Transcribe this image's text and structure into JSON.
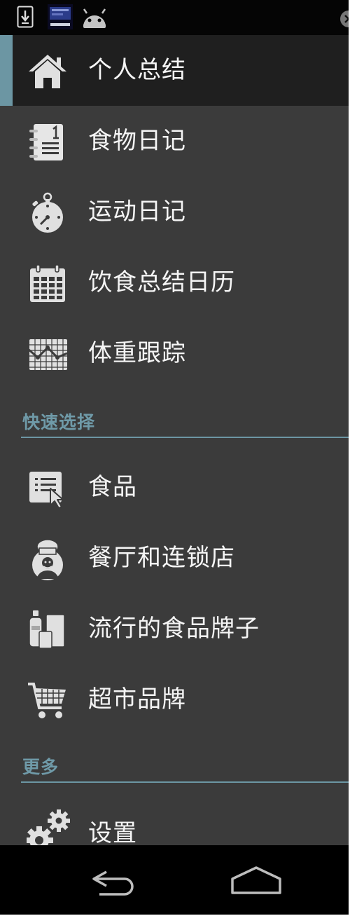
{
  "drawer": {
    "main_items": [
      {
        "label": "个人总结",
        "icon": "home-icon",
        "active": true
      },
      {
        "label": "食物日记",
        "icon": "notebook-icon"
      },
      {
        "label": "运动日记",
        "icon": "stopwatch-icon"
      },
      {
        "label": "饮食总结日历",
        "icon": "calendar-icon"
      },
      {
        "label": "体重跟踪",
        "icon": "weight-chart-icon"
      }
    ],
    "quick_select": {
      "title": "快速选择",
      "items": [
        {
          "label": "食品",
          "icon": "food-list-icon"
        },
        {
          "label": "餐厅和连锁店",
          "icon": "chef-icon"
        },
        {
          "label": "流行的食品牌子",
          "icon": "grocery-icon"
        },
        {
          "label": "超市品牌",
          "icon": "shopping-cart-icon"
        }
      ]
    },
    "more": {
      "title": "更多",
      "items": [
        {
          "label": "设置",
          "icon": "gears-icon"
        }
      ]
    }
  },
  "colors": {
    "accent": "#6c96a3",
    "drawer_bg": "#3b3b3b",
    "active_bg": "#1f1f1f"
  }
}
